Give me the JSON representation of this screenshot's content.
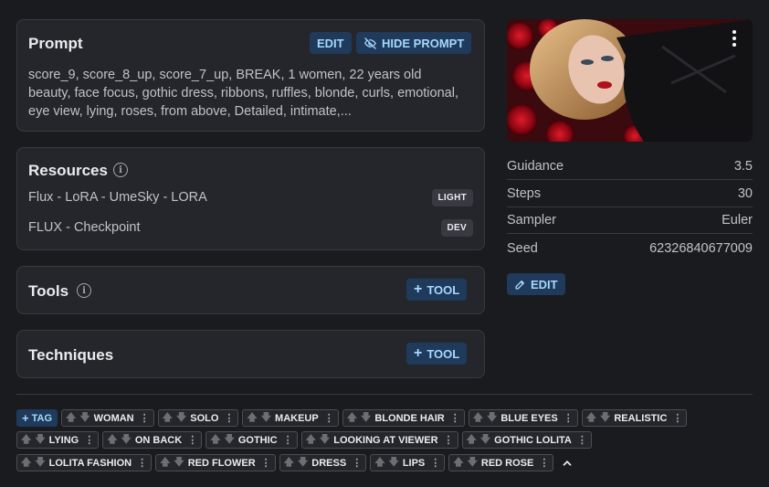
{
  "prompt": {
    "title": "Prompt",
    "edit_label": "EDIT",
    "hide_label": "HIDE PROMPT",
    "text": "score_9, score_8_up, score_7_up, BREAK, 1 women, 22 years old beauty, face focus, gothic dress, ribbons, ruffles, blonde, curls, emotional, eye view, lying, roses, from above, Detailed, intimate,..."
  },
  "resources": {
    "title": "Resources",
    "items": [
      {
        "name": "Flux - LoRA - UmeSky - LORA",
        "badge": "LIGHT"
      },
      {
        "name": "FLUX - Checkpoint",
        "badge": "DEV"
      }
    ]
  },
  "tools": {
    "title": "Tools",
    "add_label": "TOOL"
  },
  "techniques": {
    "title": "Techniques",
    "add_label": "TOOL"
  },
  "meta": [
    {
      "label": "Guidance",
      "value": "3.5"
    },
    {
      "label": "Steps",
      "value": "30"
    },
    {
      "label": "Sampler",
      "value": "Euler"
    },
    {
      "label": "Seed",
      "value": "62326840677009"
    }
  ],
  "meta_edit_label": "EDIT",
  "add_tag_label": "TAG",
  "tags": [
    "WOMAN",
    "SOLO",
    "MAKEUP",
    "BLONDE HAIR",
    "BLUE EYES",
    "REALISTIC",
    "LYING",
    "ON BACK",
    "GOTHIC",
    "LOOKING AT VIEWER",
    "GOTHIC LOLITA",
    "LOLITA FASHION",
    "RED FLOWER",
    "DRESS",
    "LIPS",
    "RED ROSE"
  ],
  "colors": {
    "accent": "#a5d8ff",
    "accent_bg": "#1f3a5a",
    "card_bg": "#25262b",
    "page_bg": "#1a1b1e"
  }
}
